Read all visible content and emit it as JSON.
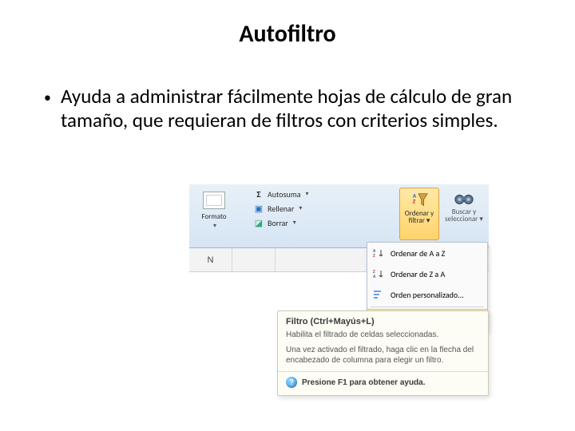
{
  "title": "Autofiltro",
  "bullet_text": "Ayuda a administrar fácilmente hojas de cálculo de gran tamaño, que requieran de filtros con criterios simples.",
  "ribbon": {
    "autosuma": "Autosuma",
    "rellenar": "Rellenar",
    "borrar": "Borrar",
    "formato": "Formato",
    "ordenar_filtrar": "Ordenar y filtrar",
    "buscar_seleccionar": "Buscar y seleccionar"
  },
  "column_header": "N",
  "menu": {
    "sort_az": "Ordenar de A a Z",
    "sort_za": "Ordenar de Z a A",
    "custom": "Orden personalizado...",
    "filter": "Filtro"
  },
  "tooltip": {
    "title": "Filtro (Ctrl+Mayús+L)",
    "line1": "Habilita el filtrado de celdas seleccionadas.",
    "line2": "Una vez activado el filtrado, haga clic en la flecha del encabezado de columna para elegir un filtro.",
    "help": "Presione F1 para obtener ayuda."
  }
}
